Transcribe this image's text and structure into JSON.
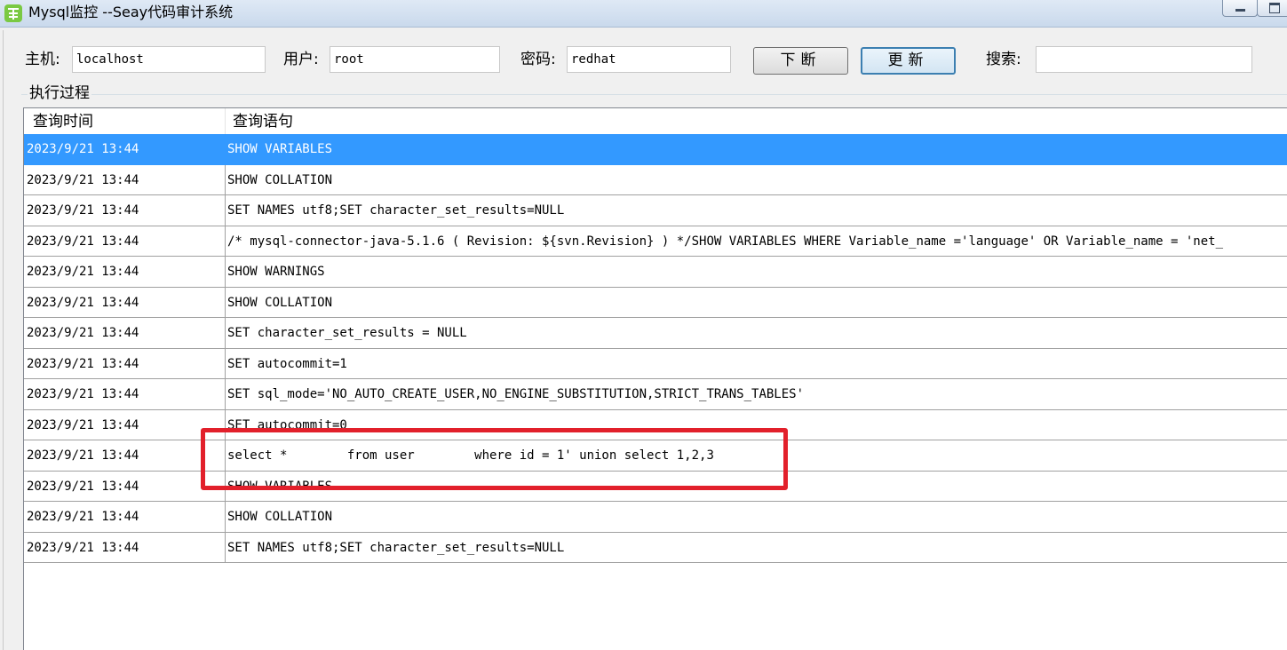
{
  "window": {
    "title": "Mysql监控 --Seay代码审计系统",
    "icon": "seay-logo-icon",
    "controls": [
      "minimize-icon",
      "maximize-icon"
    ]
  },
  "form": {
    "host_label": "主机:",
    "host_value": "localhost",
    "user_label": "用户:",
    "user_value": "root",
    "password_label": "密码:",
    "password_value": "redhat",
    "break_button": "下断",
    "update_button": "更新",
    "search_label": "搜索:",
    "search_value": ""
  },
  "group_title": "执行过程",
  "table": {
    "columns": [
      "查询时间",
      "查询语句"
    ],
    "rows": [
      {
        "time": "2023/9/21 13:44",
        "query": "SHOW VARIABLES",
        "selected": true
      },
      {
        "time": "2023/9/21 13:44",
        "query": "SHOW COLLATION"
      },
      {
        "time": "2023/9/21 13:44",
        "query": "SET NAMES utf8;SET character_set_results=NULL"
      },
      {
        "time": "2023/9/21 13:44",
        "query": "/* mysql-connector-java-5.1.6 ( Revision: ${svn.Revision} ) */SHOW VARIABLES WHERE Variable_name ='language' OR Variable_name = 'net_"
      },
      {
        "time": "2023/9/21 13:44",
        "query": "SHOW WARNINGS"
      },
      {
        "time": "2023/9/21 13:44",
        "query": "SHOW COLLATION"
      },
      {
        "time": "2023/9/21 13:44",
        "query": "SET character_set_results = NULL"
      },
      {
        "time": "2023/9/21 13:44",
        "query": "SET autocommit=1"
      },
      {
        "time": "2023/9/21 13:44",
        "query": "SET sql_mode='NO_AUTO_CREATE_USER,NO_ENGINE_SUBSTITUTION,STRICT_TRANS_TABLES'"
      },
      {
        "time": "2023/9/21 13:44",
        "query": "SET autocommit=0"
      },
      {
        "time": "2023/9/21 13:44",
        "query": "select *        from user        where id = 1' union select 1,2,3"
      },
      {
        "time": "2023/9/21 13:44",
        "query": "SHOW VARIABLES"
      },
      {
        "time": "2023/9/21 13:44",
        "query": "SHOW COLLATION"
      },
      {
        "time": "2023/9/21 13:44",
        "query": "SET NAMES utf8;SET character_set_results=NULL"
      }
    ]
  },
  "colors": {
    "selection": "#3399ff",
    "annotation": "#e2202b"
  }
}
